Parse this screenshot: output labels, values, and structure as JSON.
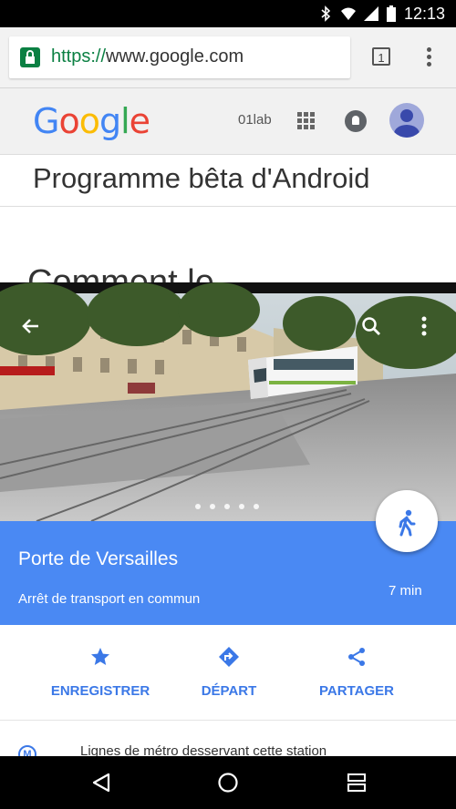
{
  "status_bar": {
    "time": "12:13"
  },
  "browser": {
    "url_protocol": "https://",
    "url_host": "www.google.com",
    "tab_count": "1"
  },
  "google_header": {
    "logo": "Google",
    "user_label": "01lab"
  },
  "page": {
    "title": "Programme bêta d'Android",
    "partial_heading": "Comment le"
  },
  "maps_card": {
    "place_name": "Porte de Versailles",
    "place_type": "Arrêt de transport en commun",
    "eta": "7 min",
    "actions": [
      {
        "label": "ENREGISTRER",
        "icon": "star-icon"
      },
      {
        "label": "DÉPART",
        "icon": "directions-icon"
      },
      {
        "label": "PARTAGER",
        "icon": "share-icon"
      }
    ],
    "lines_text": "Lignes de métro desservant cette station"
  },
  "colors": {
    "accent_blue": "#4a89f3",
    "action_blue": "#3b78e7",
    "secure_green": "#0b8043"
  }
}
